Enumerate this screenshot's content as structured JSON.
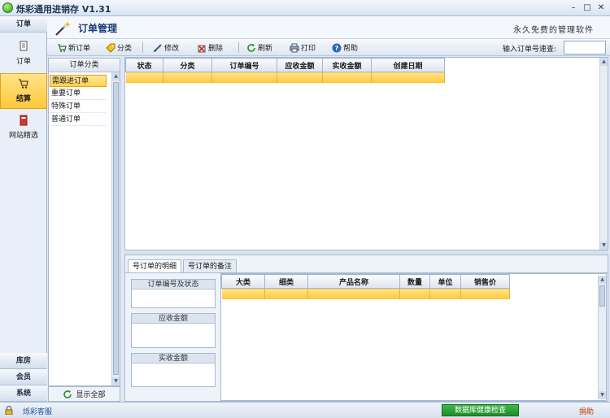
{
  "window": {
    "title": "烁彩通用进销存 V1.31",
    "controls": [
      "–",
      "□",
      "✕"
    ]
  },
  "header": {
    "title": "订单管理",
    "slogan": "永久免费的管理软件"
  },
  "leftnav": {
    "top_tab": "订单",
    "items": [
      {
        "label": "订单",
        "icon": "document-icon"
      },
      {
        "label": "结算",
        "icon": "cart-icon",
        "active": true
      },
      {
        "label": "网站精选",
        "icon": "book-icon"
      }
    ],
    "bottom_tabs": [
      "库房",
      "会员",
      "系统"
    ]
  },
  "toolbar": {
    "buttons": [
      {
        "label": "新订单",
        "icon": "new-order-icon"
      },
      {
        "label": "分类",
        "icon": "tag-icon"
      },
      {
        "label": "修改",
        "icon": "edit-icon"
      },
      {
        "label": "删除",
        "icon": "delete-icon"
      },
      {
        "label": "刷新",
        "icon": "refresh-icon"
      },
      {
        "label": "打印",
        "icon": "print-icon"
      },
      {
        "label": "帮助",
        "icon": "help-icon"
      }
    ],
    "quick_search_label": "输入订单号速查:",
    "quick_search_value": ""
  },
  "categories": {
    "header": "订单分类",
    "items": [
      "需跟进订单",
      "重要订单",
      "特殊订单",
      "普通订单"
    ],
    "selected": 0,
    "show_all": "显示全部"
  },
  "orders_table": {
    "columns": [
      "状态",
      "分类",
      "订单编号",
      "应收金额",
      "实收金额",
      "创建日期"
    ],
    "rows": []
  },
  "detail": {
    "tabs": [
      "号订单的明细",
      "号订单的备注"
    ],
    "active_tab": 0,
    "fields": [
      "订单编号及状态",
      "应收金额",
      "实收金额"
    ],
    "items_table": {
      "columns": [
        "大类",
        "细类",
        "产品名称",
        "数量",
        "单位",
        "销售价"
      ],
      "rows": []
    }
  },
  "statusbar": {
    "support": "烁彩客服",
    "health_check": "数据库健康检查",
    "donate": "捐助"
  },
  "colors": {
    "selection": "#ffcf48",
    "accent_blue": "#1b3b74",
    "panel_border": "#a7b9d1"
  }
}
